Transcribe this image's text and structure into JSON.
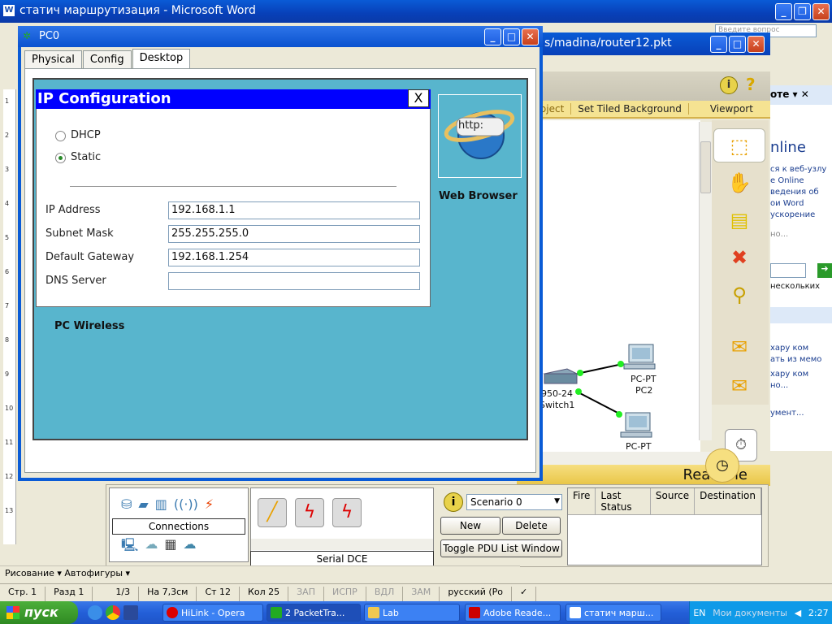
{
  "word": {
    "title": "статич маршрутизация - Microsoft Word",
    "search_placeholder": "Введите вопрос",
    "draw_toolbar": "Рисование ▾   Автофигуры ▾",
    "status": {
      "page": "Стр. 1",
      "section": "Разд 1",
      "pages": "1/3",
      "at": "На 7,3см",
      "line": "Ст 12",
      "col": "Кол 25",
      "rec": "ЗАП",
      "trk": "ИСПР",
      "ext": "ВДЛ",
      "ovr": "ЗАМ",
      "lang": "русский (Ро"
    },
    "taskpane": {
      "title": "оте",
      "big": "nline",
      "lines": [
        "ся к веб-узлу",
        "e Online",
        "ведения об",
        "ои Word",
        "ускорение",
        "но...",
        "нескольких",
        "хару ком",
        "ать из мемо",
        "хару ком",
        "но...",
        "умент..."
      ]
    },
    "ruler_marks": [
      "1",
      "2",
      "3",
      "4",
      "5",
      "6",
      "7",
      "8",
      "9",
      "10",
      "11",
      "12",
      "13"
    ]
  },
  "pt": {
    "title": "s/madina/router12.pkt",
    "bar": [
      "e Object",
      "Set Tiled Background",
      "Viewport"
    ],
    "realtime": "Realtime",
    "side_icons": [
      "select-icon",
      "hand-icon",
      "note-icon",
      "delete-icon",
      "zoom-icon",
      "add-simple-pdu-icon",
      "add-complex-pdu-icon"
    ],
    "nodes": {
      "switch": "950-24",
      "switch_name": "Switch1",
      "pc2_type": "PC-PT",
      "pc2_name": "PC2",
      "pc3_type": "PC-PT"
    },
    "bottom": {
      "connections_label": "Connections",
      "cable_label": "Serial DCE",
      "scenario": "Scenario 0",
      "new_btn": "New",
      "delete_btn": "Delete",
      "toggle_btn": "Toggle PDU List Window",
      "pdu_headers": [
        "Fire",
        "Last Status",
        "Source",
        "Destination"
      ]
    }
  },
  "pc0": {
    "title": "PC0",
    "tabs": [
      "Physical",
      "Config",
      "Desktop"
    ],
    "active_tab": "Desktop",
    "ipconfig": {
      "title": "IP Configuration",
      "close": "X",
      "dhcp": "DHCP",
      "static": "Static",
      "mode": "static",
      "ip_label": "IP Address",
      "ip_value": "192.168.1.1",
      "mask_label": "Subnet Mask",
      "mask_value": "255.255.255.0",
      "gw_label": "Default Gateway",
      "gw_value": "192.168.1.254",
      "dns_label": "DNS Server",
      "dns_value": ""
    },
    "web_browser": "Web Browser",
    "web_browser_icon": "http:",
    "pc_wireless": "PC Wireless"
  },
  "taskbar": {
    "start": "пуск",
    "items": [
      "HiLink - Opera",
      "2 PacketTra...",
      "Lab",
      "Adobe Reade...",
      "статич марш..."
    ],
    "lang": "EN",
    "docs": "Мои документы",
    "time": "2:27"
  },
  "colors": {
    "xp_blue": "#0a5bd6",
    "desktop_teal": "#58b5cd",
    "ipconfig_title": "#0000ff",
    "pt_bar": "#f5e392"
  }
}
